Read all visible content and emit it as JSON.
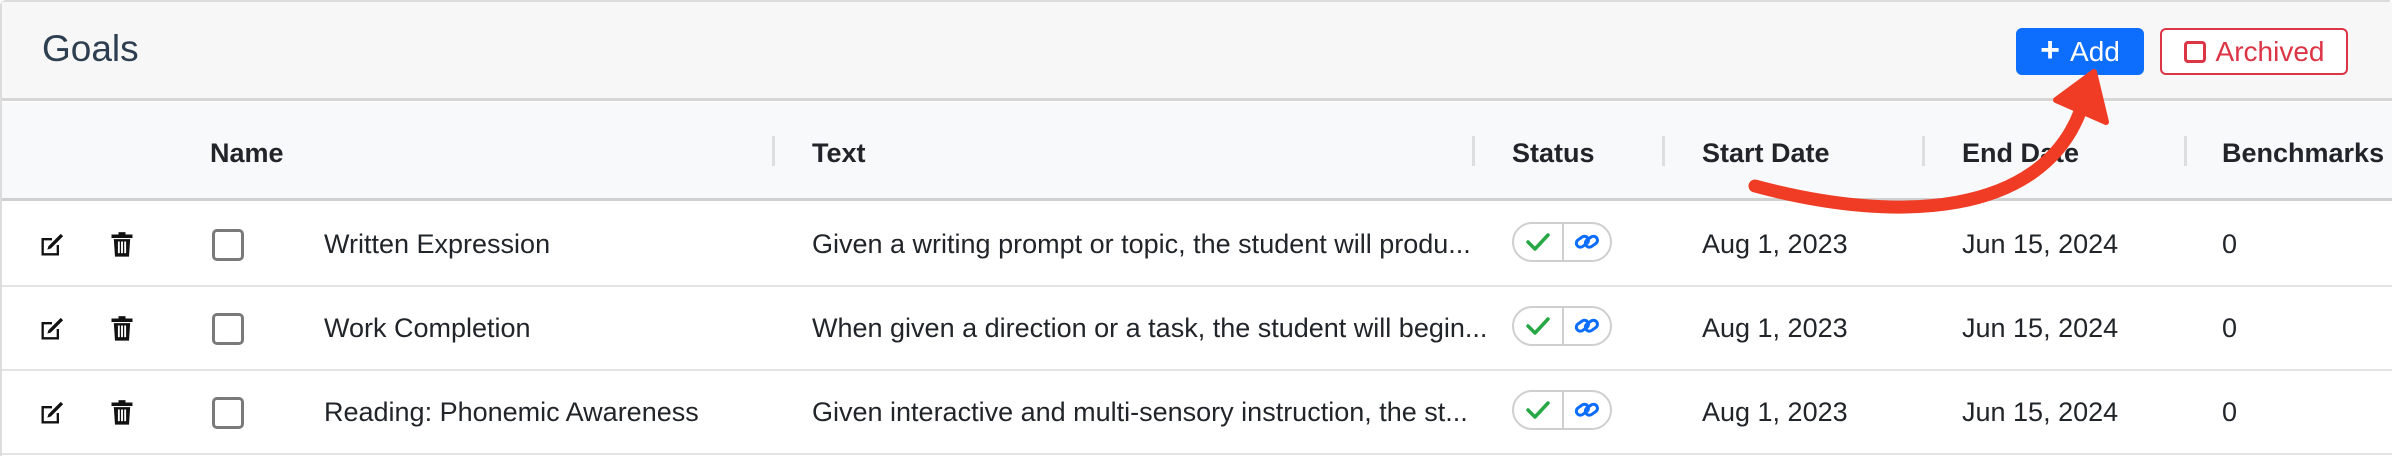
{
  "header": {
    "title": "Goals",
    "add_label": "Add",
    "archived_label": "Archived"
  },
  "table": {
    "columns": [
      "Name",
      "Text",
      "Status",
      "Start Date",
      "End Date",
      "Benchmarks"
    ],
    "rows": [
      {
        "name": "Written Expression",
        "text": "Given a writing prompt or topic, the student will produ...",
        "start": "Aug 1, 2023",
        "end": "Jun 15, 2024",
        "benchmarks": "0"
      },
      {
        "name": "Work Completion",
        "text": "When given a direction or a task, the student will begin...",
        "start": "Aug 1, 2023",
        "end": "Jun 15, 2024",
        "benchmarks": "0"
      },
      {
        "name": "Reading: Phonemic Awareness",
        "text": "Given interactive and multi-sensory instruction, the st...",
        "start": "Aug 1, 2023",
        "end": "Jun 15, 2024",
        "benchmarks": "0"
      }
    ]
  },
  "colors": {
    "primary": "#0d6efd",
    "danger": "#dc3545",
    "success": "#28a745",
    "annotation_arrow": "#f03c24"
  },
  "icons": {
    "edit": "edit-icon",
    "delete": "trash-icon",
    "status_ok": "check-icon",
    "link": "link-icon"
  }
}
